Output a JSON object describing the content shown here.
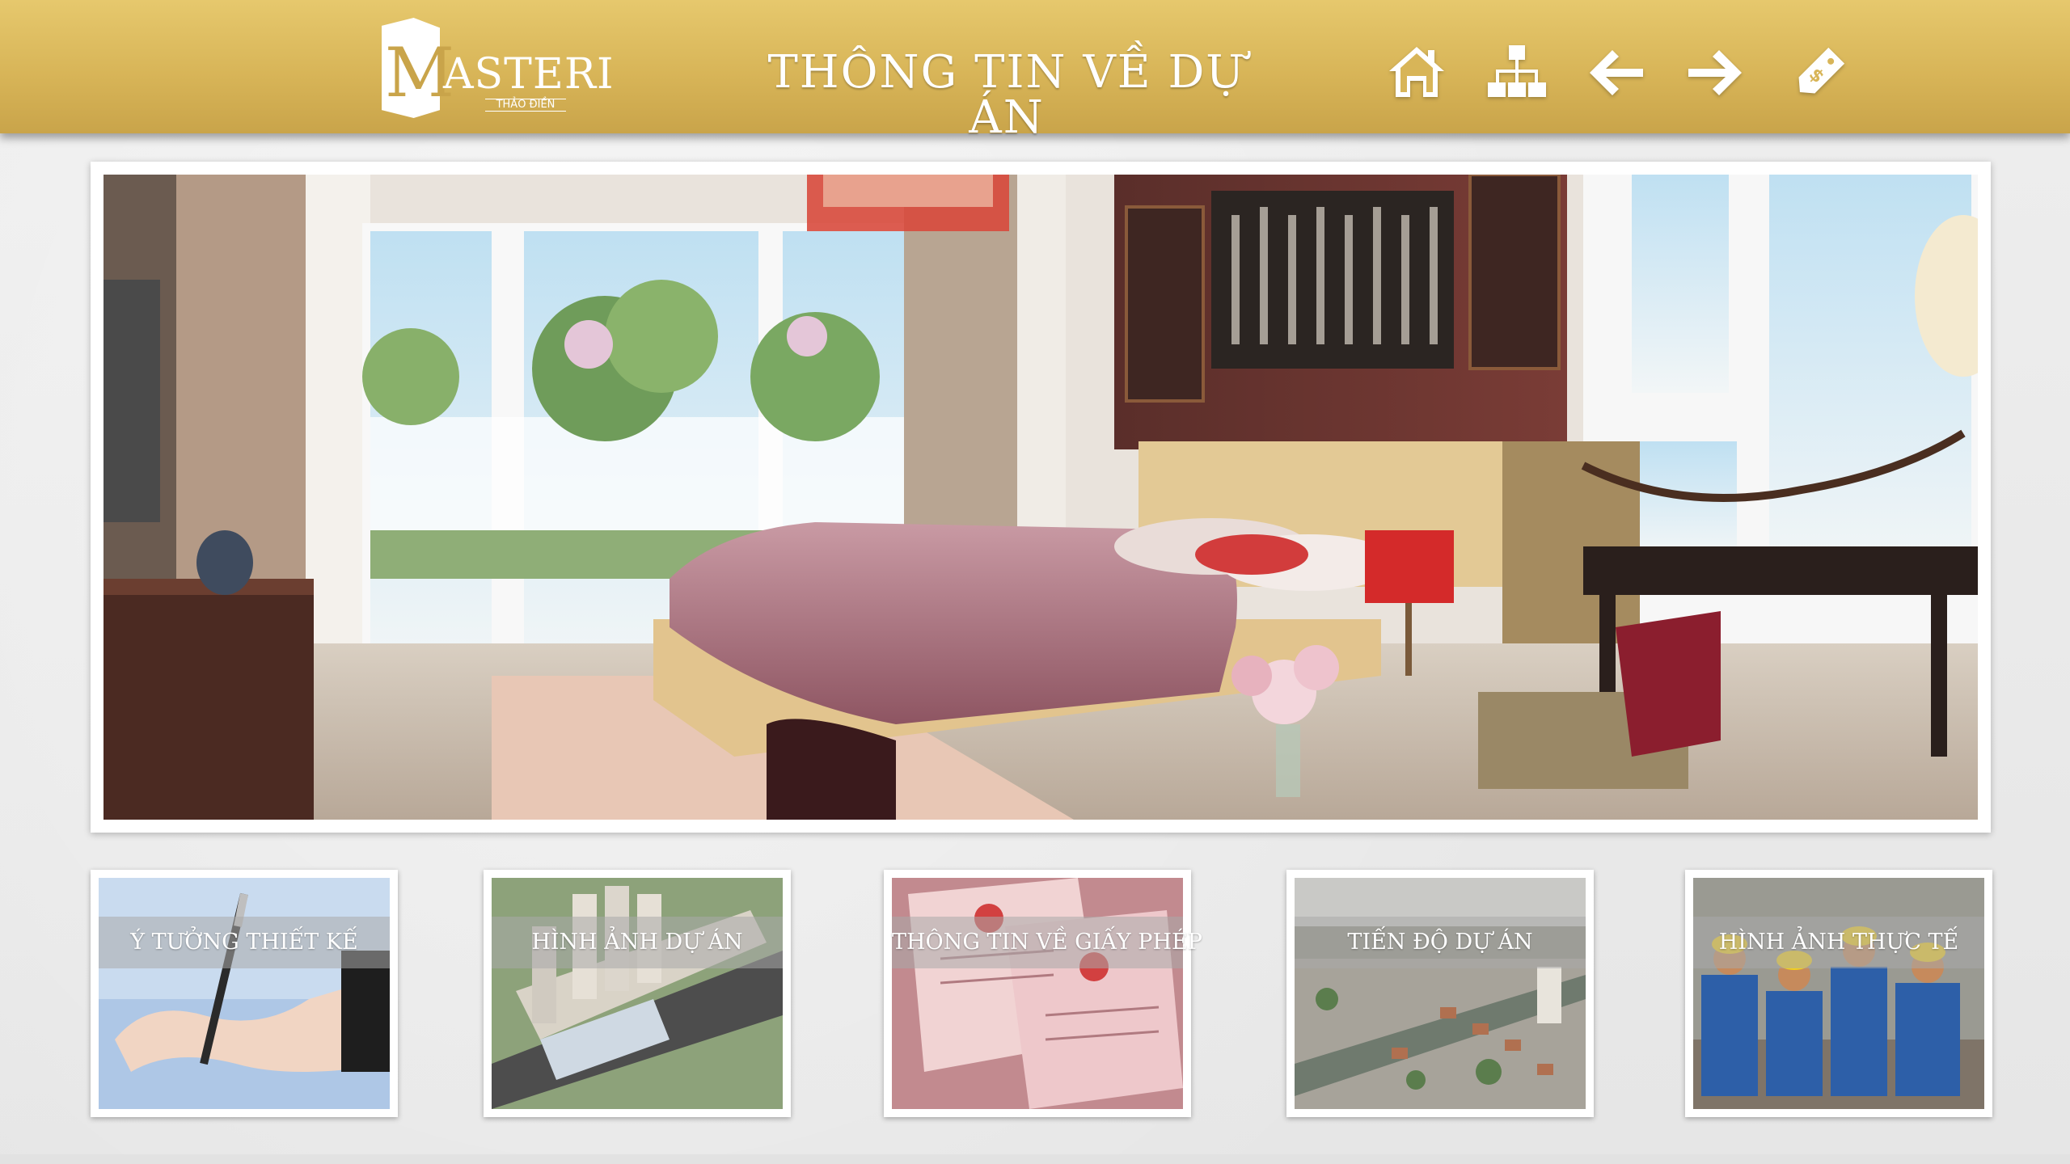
{
  "brand": {
    "logo_letter": "M",
    "logo_name": "ASTERI",
    "logo_sub": "THẢO ĐIỀN",
    "gold": "#d8b558"
  },
  "header": {
    "title": "THÔNG TIN VỀ DỰ ÁN",
    "icons": [
      "home-icon",
      "sitemap-icon",
      "arrow-left-icon",
      "arrow-right-icon",
      "price-tag-icon"
    ]
  },
  "hero": {
    "image": "bedroom-interior-render"
  },
  "tiles": [
    {
      "label": "Ý TƯỞNG THIẾT KẾ",
      "image": "hand-writing-pen"
    },
    {
      "label": "HÌNH ẢNH DỰ ÁN",
      "image": "project-aerial-render"
    },
    {
      "label": "THÔNG TIN VỀ GIẤY PHÉP",
      "image": "license-documents"
    },
    {
      "label": "TIẾN ĐỘ DỰ ÁN",
      "image": "city-aerial-photo"
    },
    {
      "label": "HÌNH ẢNH THỰC TẾ",
      "image": "construction-workers"
    }
  ]
}
